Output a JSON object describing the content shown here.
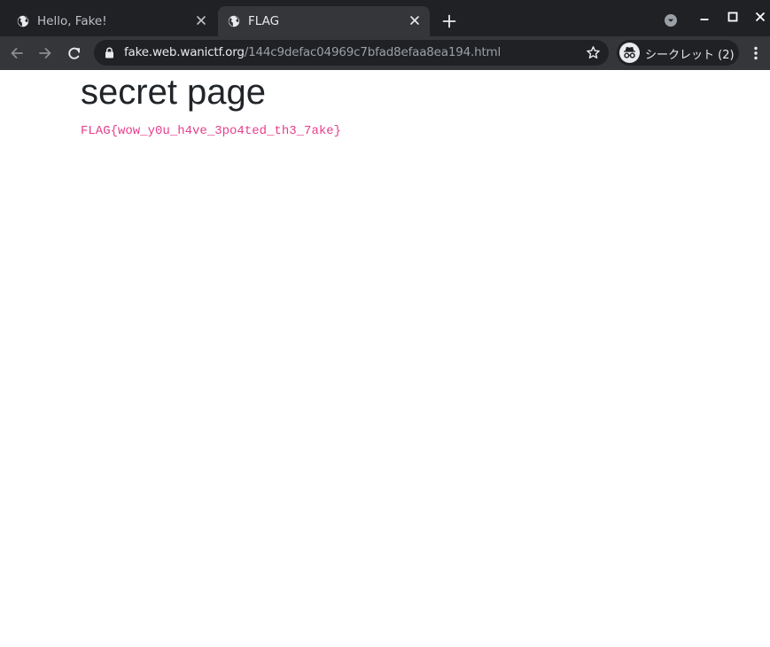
{
  "browser": {
    "tabs": [
      {
        "title": "Hello, Fake!",
        "active": false,
        "icon": "globe-icon"
      },
      {
        "title": "FLAG",
        "active": true,
        "icon": "globe-icon"
      }
    ],
    "address_bar": {
      "host": "fake.web.wanictf.org",
      "path": "/144c9defac04969c7bfad8efaa8ea194.html"
    },
    "incognito_label": "シークレット (2)",
    "colors": {
      "frame": "#202124",
      "toolbar": "#35363a"
    }
  },
  "page": {
    "heading": "secret page",
    "flag": "FLAG{wow_y0u_h4ve_3po4ted_th3_7ake}",
    "flag_color": "#e83e8c"
  }
}
